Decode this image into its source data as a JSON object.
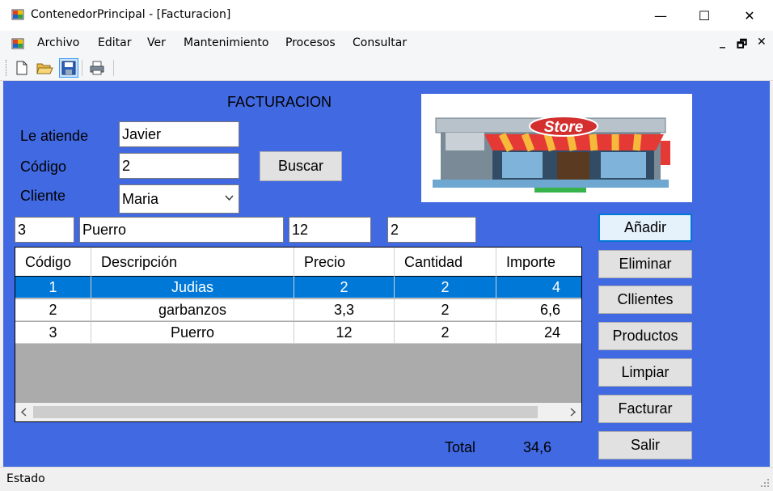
{
  "window": {
    "title": "ContenedorPrincipal - [Facturacion]"
  },
  "caption_buttons": {
    "minimize": "—",
    "maximize": "☐",
    "close": "✕"
  },
  "menu": [
    "Archivo",
    "Editar",
    "Ver",
    "Mantenimiento",
    "Procesos",
    "Consultar"
  ],
  "mdi_controls": {
    "minimize": "_",
    "restore": "🗗",
    "close": "✕"
  },
  "toolbar": [
    "new-icon",
    "open-icon",
    "save-icon",
    "print-icon"
  ],
  "form": {
    "title": "FACTURACION",
    "le_atiende_label": "Le atiende",
    "le_atiende_value": "Javier",
    "codigo_label": "Código",
    "codigo_value": "2",
    "cliente_label": "Cliente",
    "cliente_value": "Maria",
    "buscar_label": "Buscar",
    "line_codigo": "3",
    "line_descripcion": "Puerro",
    "line_precio": "12",
    "line_cantidad": "2",
    "store_sign": "Store"
  },
  "buttons": [
    "Añadir",
    "Eliminar",
    "Cllientes",
    "Productos",
    "Limpiar",
    "Facturar",
    "Salir"
  ],
  "grid": {
    "columns": [
      "Código",
      "Descripción",
      "Precio",
      "Cantidad",
      "Importe"
    ],
    "rows": [
      [
        "1",
        "Judias",
        "2",
        "2",
        "4"
      ],
      [
        "2",
        "garbanzos",
        "3,3",
        "2",
        "6,6"
      ],
      [
        "3",
        "Puerro",
        "12",
        "2",
        "24"
      ]
    ],
    "selected_row": 0
  },
  "totals": {
    "label": "Total",
    "value": "34,6"
  },
  "status": {
    "text": "Estado"
  }
}
